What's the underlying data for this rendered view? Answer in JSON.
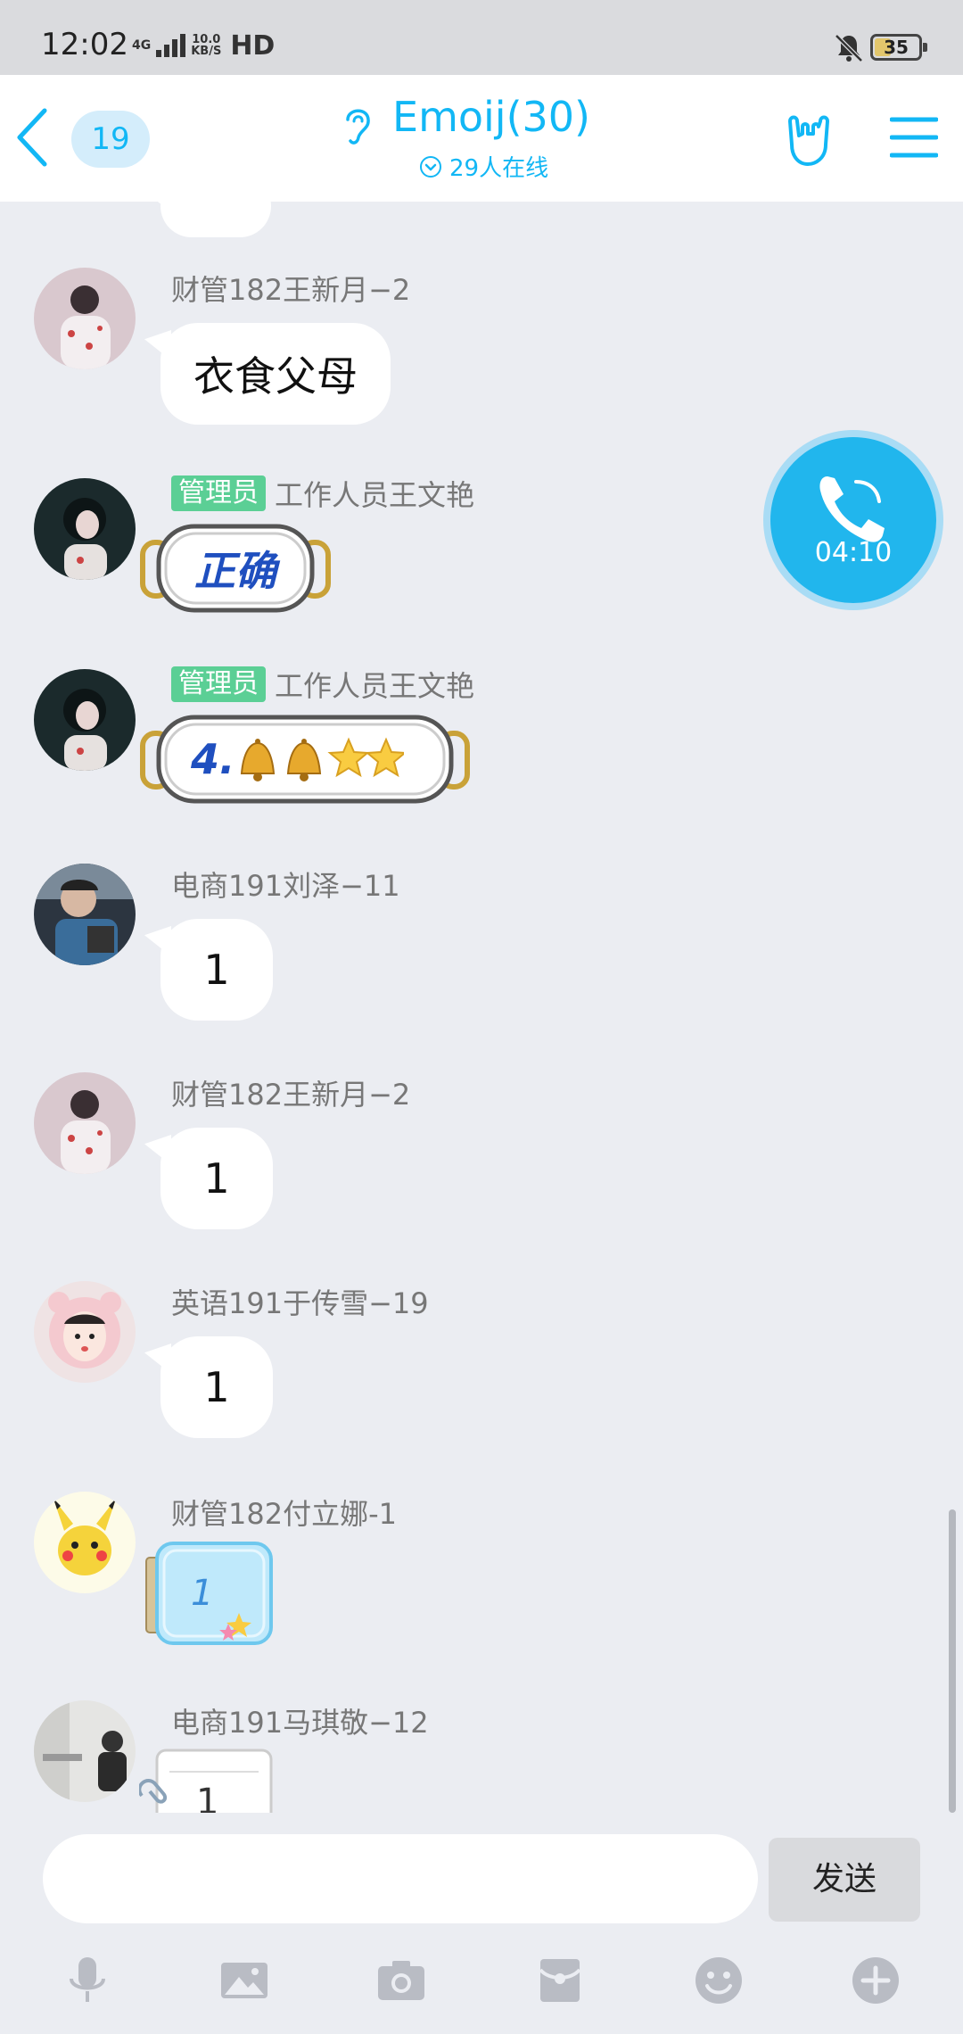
{
  "status_bar": {
    "time": "12:02",
    "network": "4G",
    "speed_value": "10.0",
    "speed_unit": "KB/S",
    "hd": "HD",
    "battery": "35"
  },
  "header": {
    "unread_count": "19",
    "title": "Emoij(30)",
    "online": "29人在线"
  },
  "call": {
    "duration": "04:10"
  },
  "messages": [
    {
      "sender": "财管182王新月−2",
      "text": "衣食父母"
    },
    {
      "admin_label": "管理员",
      "sender": "工作人员王文艳",
      "sticker_text": "正确"
    },
    {
      "admin_label": "管理员",
      "sender": "工作人员王文艳",
      "sticker_text": "4."
    },
    {
      "sender": "电商191刘泽−11",
      "text": "1"
    },
    {
      "sender": "财管182王新月−2",
      "text": "1"
    },
    {
      "sender": "英语191于传雪−19",
      "text": "1"
    },
    {
      "sender": "财管182付立娜-1",
      "sticker_text": "1"
    },
    {
      "sender": "电商191马琪敬−12",
      "sticker_text": "1"
    }
  ],
  "composer": {
    "placeholder": "",
    "send_label": "发送"
  },
  "toolbar_icons": [
    "microphone-icon",
    "image-icon",
    "camera-icon",
    "red-packet-icon",
    "emoji-icon",
    "plus-icon"
  ],
  "colors": {
    "accent": "#12b7f5",
    "admin_tag": "#5bcf95",
    "background": "#ebedf2"
  }
}
